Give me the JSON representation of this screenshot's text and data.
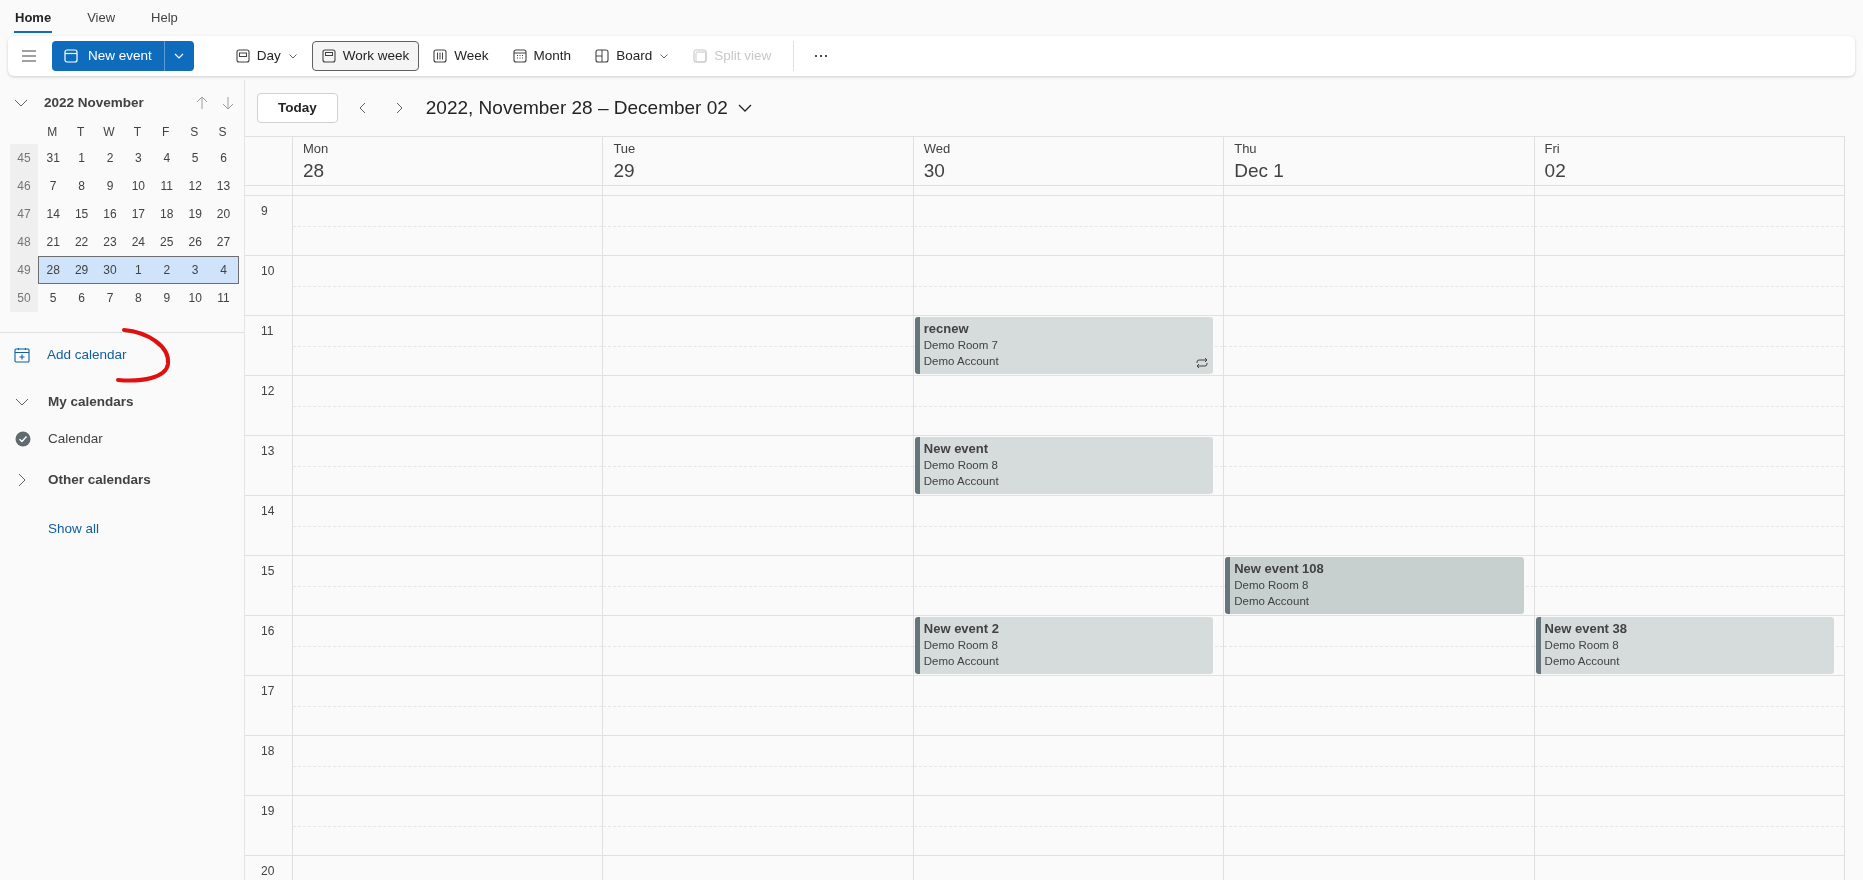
{
  "menu_tabs": [
    {
      "label": "Home",
      "selected": true
    },
    {
      "label": "View",
      "selected": false
    },
    {
      "label": "Help",
      "selected": false
    }
  ],
  "toolbar": {
    "new_event": "New event",
    "views": [
      {
        "label": "Day",
        "kind": "day",
        "selected": false,
        "disabled": false,
        "dropdown": true
      },
      {
        "label": "Work week",
        "kind": "workweek",
        "selected": true,
        "disabled": false,
        "dropdown": false
      },
      {
        "label": "Week",
        "kind": "week",
        "selected": false,
        "disabled": false,
        "dropdown": false
      },
      {
        "label": "Month",
        "kind": "month",
        "selected": false,
        "disabled": false,
        "dropdown": false
      },
      {
        "label": "Board",
        "kind": "board",
        "selected": false,
        "disabled": false,
        "dropdown": true
      },
      {
        "label": "Split view",
        "kind": "split",
        "selected": false,
        "disabled": true,
        "dropdown": false
      }
    ]
  },
  "mini_calendar": {
    "title": "2022 November",
    "weekdays": [
      "M",
      "T",
      "W",
      "T",
      "F",
      "S",
      "S"
    ],
    "weeks": [
      {
        "number": "45",
        "days": [
          "31",
          "1",
          "2",
          "3",
          "4",
          "5",
          "6"
        ],
        "selected": false
      },
      {
        "number": "46",
        "days": [
          "7",
          "8",
          "9",
          "10",
          "11",
          "12",
          "13"
        ],
        "selected": false
      },
      {
        "number": "47",
        "days": [
          "14",
          "15",
          "16",
          "17",
          "18",
          "19",
          "20"
        ],
        "selected": false
      },
      {
        "number": "48",
        "days": [
          "21",
          "22",
          "23",
          "24",
          "25",
          "26",
          "27"
        ],
        "selected": false
      },
      {
        "number": "49",
        "days": [
          "28",
          "29",
          "30",
          "1",
          "2",
          "3",
          "4"
        ],
        "selected": true
      },
      {
        "number": "50",
        "days": [
          "5",
          "6",
          "7",
          "8",
          "9",
          "10",
          "11"
        ],
        "selected": false
      }
    ]
  },
  "sidebar": {
    "add_calendar": "Add calendar",
    "groups": [
      {
        "label": "My calendars",
        "expanded": true,
        "calendars": [
          {
            "label": "Calendar",
            "checked": true
          }
        ]
      },
      {
        "label": "Other calendars",
        "expanded": false
      }
    ],
    "show_all": "Show all"
  },
  "navigation": {
    "today": "Today",
    "range": "2022, November 28 – December 02"
  },
  "days": [
    {
      "weekday": "Mon",
      "date": "28"
    },
    {
      "weekday": "Tue",
      "date": "29"
    },
    {
      "weekday": "Wed",
      "date": "30"
    },
    {
      "weekday": "Thu",
      "date": "Dec 1"
    },
    {
      "weekday": "Fri",
      "date": "02"
    }
  ],
  "hours": [
    {
      "label": "9",
      "cells": [
        null,
        null,
        null,
        null,
        null
      ]
    },
    {
      "label": "10",
      "cells": [
        null,
        null,
        null,
        null,
        null
      ]
    },
    {
      "label": "11",
      "cells": [
        null,
        null,
        {
          "title": "recnew",
          "room": "Demo Room 7",
          "account": "Demo Account",
          "recurring": true,
          "color": "#d6dbdb"
        },
        null,
        null
      ]
    },
    {
      "label": "12",
      "cells": [
        null,
        null,
        null,
        null,
        null
      ]
    },
    {
      "label": "13",
      "cells": [
        null,
        null,
        {
          "title": "New event",
          "room": "Demo Room 8",
          "account": "Demo Account",
          "recurring": false,
          "color": "#d6dbdb"
        },
        null,
        null
      ]
    },
    {
      "label": "14",
      "cells": [
        null,
        null,
        null,
        null,
        null
      ]
    },
    {
      "label": "15",
      "cells": [
        null,
        null,
        null,
        {
          "title": "New event 108",
          "room": "Demo Room 8",
          "account": "Demo Account",
          "recurring": false,
          "color": "#c8cfcf"
        },
        null
      ]
    },
    {
      "label": "16",
      "cells": [
        null,
        null,
        {
          "title": "New event 2",
          "room": "Demo Room 8",
          "account": "Demo Account",
          "recurring": false,
          "color": "#d6dbdb"
        },
        null,
        {
          "title": "New event 38",
          "room": "Demo Room 8",
          "account": "Demo Account",
          "recurring": false,
          "color": "#d6dbdb"
        }
      ]
    },
    {
      "label": "17",
      "cells": [
        null,
        null,
        null,
        null,
        null
      ]
    },
    {
      "label": "18",
      "cells": [
        null,
        null,
        null,
        null,
        null
      ]
    },
    {
      "label": "19",
      "cells": [
        null,
        null,
        null,
        null,
        null
      ]
    },
    {
      "label": "20",
      "cells": [
        null,
        null,
        null,
        null,
        null
      ]
    }
  ]
}
